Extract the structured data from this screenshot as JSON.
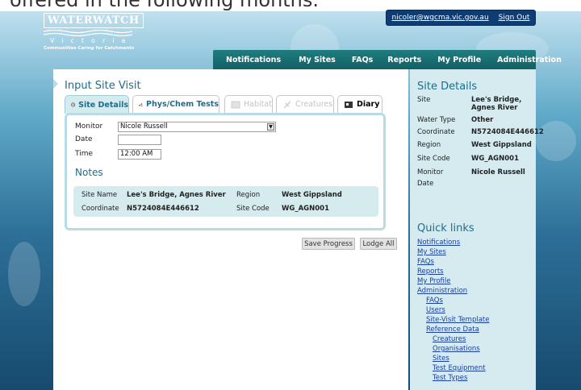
{
  "page_caption": "offered in the following months.",
  "header": {
    "logo_name": "WATERWATCH",
    "logo_region": "Victoria",
    "logo_tagline": "Communities Caring for Catchments",
    "account_email": "nicoler@wgcma.vic.gov.au",
    "sign_out": "Sign Out"
  },
  "nav": [
    "Notifications",
    "My Sites",
    "FAQs",
    "Reports",
    "My Profile",
    "Administration"
  ],
  "main": {
    "title": "Input Site Visit",
    "tabs": [
      {
        "label": "Site Details",
        "icon": "clock-icon",
        "state": "active"
      },
      {
        "label": "Phys/Chem Tests",
        "icon": "molecule-icon",
        "state": "normal"
      },
      {
        "label": "Habitat",
        "icon": "habitat-icon",
        "state": "disabled"
      },
      {
        "label": "Creatures",
        "icon": "creature-icon",
        "state": "disabled"
      },
      {
        "label": "Diary",
        "icon": "diary-icon",
        "state": "normal"
      }
    ],
    "form": {
      "monitor_label": "Monitor",
      "monitor_value": "Nicole Russell",
      "date_label": "Date",
      "date_value": "",
      "time_label": "Time",
      "time_value": "12:00 AM"
    },
    "notes_title": "Notes",
    "summary": {
      "site_name_label": "Site Name",
      "site_name_value": "Lee's Bridge, Agnes River",
      "region_label": "Region",
      "region_value": "West Gippsland",
      "coordinate_label": "Coordinate",
      "coordinate_value": "N5724084E446612",
      "site_code_label": "Site Code",
      "site_code_value": "WG_AGN001"
    },
    "buttons": {
      "save": "Save Progress",
      "lodge": "Lodge All"
    }
  },
  "side": {
    "details_title": "Site Details",
    "details": [
      {
        "key": "Site",
        "value": "Lee's Bridge, Agnes River"
      },
      {
        "key": "Water Type",
        "value": "Other"
      },
      {
        "key": "Coordinate",
        "value": "N5724084E446612"
      },
      {
        "key": "Region",
        "value": "West Gippsland"
      },
      {
        "key": "Site Code",
        "value": "WG_AGN001"
      },
      {
        "key": "Monitor",
        "value": "Nicole Russell"
      },
      {
        "key": "Date",
        "value": ""
      }
    ],
    "quick_links_title": "Quick links",
    "quick_links": [
      {
        "label": "Notifications",
        "level": 0
      },
      {
        "label": "My Sites",
        "level": 0
      },
      {
        "label": "FAQs",
        "level": 0
      },
      {
        "label": "Reports",
        "level": 0
      },
      {
        "label": "My Profile",
        "level": 0
      },
      {
        "label": "Administration",
        "level": 0
      },
      {
        "label": "FAQs",
        "level": 1
      },
      {
        "label": "Users",
        "level": 1
      },
      {
        "label": "Site-Visit Template",
        "level": 1
      },
      {
        "label": "Reference Data",
        "level": 1
      },
      {
        "label": "Creatures",
        "level": 2
      },
      {
        "label": "Organisations",
        "level": 2
      },
      {
        "label": "Sites",
        "level": 2
      },
      {
        "label": "Test Equipment",
        "level": 2
      },
      {
        "label": "Test Types",
        "level": 2
      }
    ]
  }
}
